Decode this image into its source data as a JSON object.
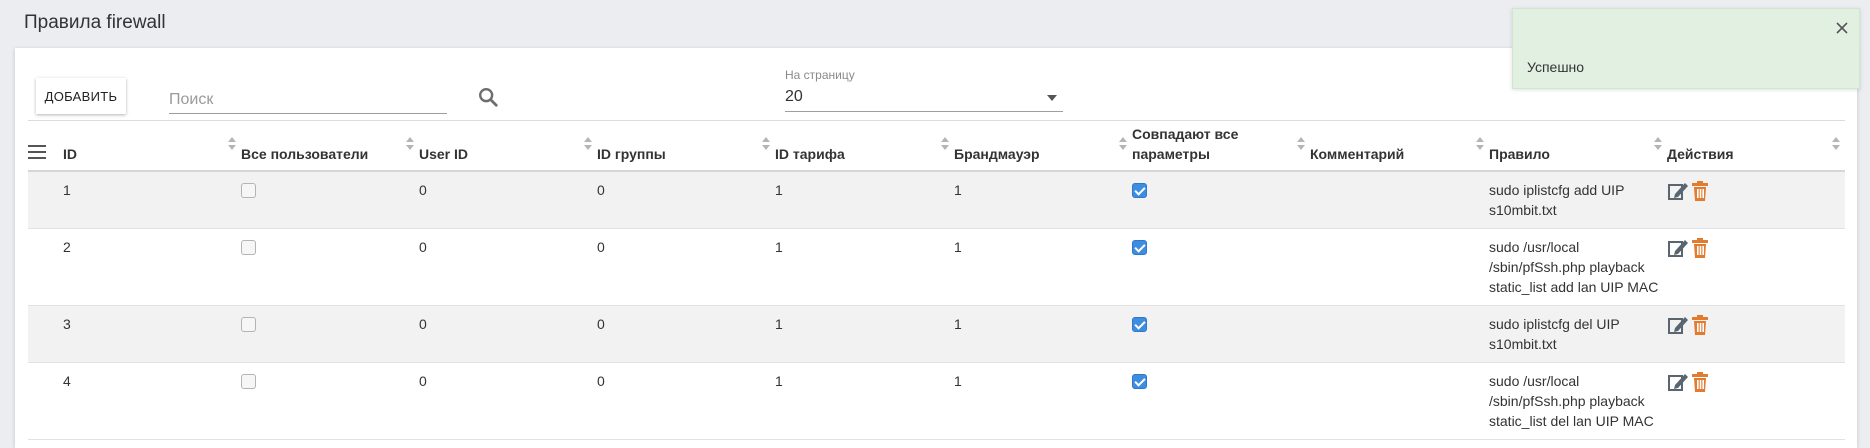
{
  "page": {
    "title": "Правила firewall"
  },
  "toolbar": {
    "add_label": "ДОБАВИТЬ",
    "search_placeholder": "Поиск",
    "search_value": "",
    "per_page_label": "На страницу",
    "per_page_value": "20"
  },
  "table": {
    "columns": [
      "ID",
      "Все пользователи",
      "User ID",
      "ID группы",
      "ID тарифа",
      "Брандмауэр",
      "Совпадают все параметры",
      "Комментарий",
      "Правило",
      "Действия"
    ],
    "rows": [
      {
        "id": "1",
        "all_users": false,
        "user_id": "0",
        "group_id": "0",
        "tariff_id": "1",
        "firewall": "1",
        "match_all": true,
        "comment": "",
        "rule": "sudo iplistcfg add UIP s10mbit.txt"
      },
      {
        "id": "2",
        "all_users": false,
        "user_id": "0",
        "group_id": "0",
        "tariff_id": "1",
        "firewall": "1",
        "match_all": true,
        "comment": "",
        "rule": "sudo /usr/local /sbin/pfSsh.php playback static_list add lan UIP MAC"
      },
      {
        "id": "3",
        "all_users": false,
        "user_id": "0",
        "group_id": "0",
        "tariff_id": "1",
        "firewall": "1",
        "match_all": true,
        "comment": "",
        "rule": "sudo iplistcfg del UIP s10mbit.txt"
      },
      {
        "id": "4",
        "all_users": false,
        "user_id": "0",
        "group_id": "0",
        "tariff_id": "1",
        "firewall": "1",
        "match_all": true,
        "comment": "",
        "rule": "sudo /usr/local /sbin/pfSsh.php playback static_list del lan UIP MAC"
      }
    ]
  },
  "toast": {
    "message": "Успешно"
  },
  "icons": {
    "edit": "edit-icon",
    "delete": "trash-icon",
    "search": "search-icon",
    "menu": "menu-icon",
    "close": "close-icon"
  },
  "colors": {
    "accent_checkbox": "#3d8ee0",
    "edit_icon": "#5a6570",
    "delete_icon": "#e07b2f",
    "toast_bg": "#e2f0e2"
  }
}
